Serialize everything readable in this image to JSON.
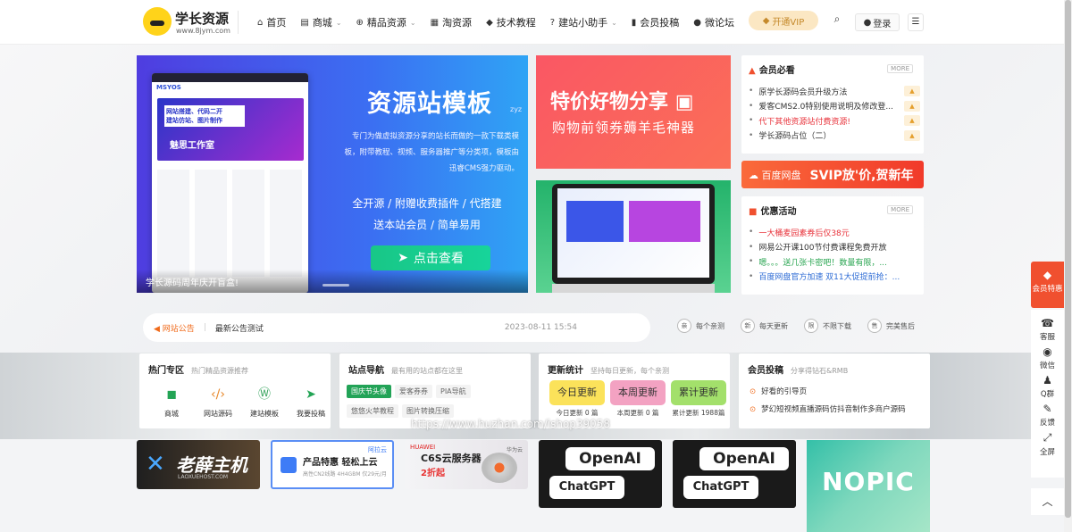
{
  "logo": {
    "title": "学长资源",
    "url_text": "www.8jym.com"
  },
  "nav": [
    {
      "icon": "home-icon",
      "glyph": "⌂",
      "label": "首页",
      "dropdown": false
    },
    {
      "icon": "store-icon",
      "glyph": "▤",
      "label": "商城",
      "dropdown": true
    },
    {
      "icon": "globe-icon",
      "glyph": "⊕",
      "label": "精品资源",
      "dropdown": true
    },
    {
      "icon": "shop-icon",
      "glyph": "▦",
      "label": "淘资源",
      "dropdown": false
    },
    {
      "icon": "graduation-cap-icon",
      "glyph": "◆",
      "label": "技术教程",
      "dropdown": false
    },
    {
      "icon": "question-icon",
      "glyph": "?",
      "label": "建站小助手",
      "dropdown": true
    },
    {
      "icon": "book-icon",
      "glyph": "▮",
      "label": "会员投稿",
      "dropdown": false
    },
    {
      "icon": "chat-icon",
      "glyph": "●",
      "label": "微论坛",
      "dropdown": false
    }
  ],
  "header": {
    "vip_label": "开通VIP",
    "login_label": "登录"
  },
  "hero": {
    "title": "资源站模板",
    "subtitle": "zyz",
    "desc": "专门为做虚拟资源分享的站长而做的一款下载类模板，附带教程、视频、服务器推广等分类项，模板由迅睿CMS强力驱动。",
    "features_1": "全开源 / 附赠收费插件 / 代搭建",
    "features_2": "送本站会员 / 简单易用",
    "button": "点击查看",
    "caption": "学长源码周年庆开盲盒!",
    "mock_brand": "MSYOS",
    "mock_banner_1": "网站搭建、代码二开",
    "mock_banner_2": "建站仿站、图片制作",
    "mock_banner_3": "魅思工作室"
  },
  "ad_sale": {
    "title": "特价好物分享",
    "subtitle": "购物前领券薅羊毛神器"
  },
  "member_must": {
    "title": "会员必看",
    "more": "MORE",
    "items": [
      {
        "text": "原学长源码会员升级方法",
        "style": ""
      },
      {
        "text": "爱客CMS2.0特别使用说明及修改登...",
        "style": ""
      },
      {
        "text": "代下其他资源站付费资源!",
        "style": "red"
      },
      {
        "text": "学长源码占位（二）",
        "style": ""
      }
    ]
  },
  "baidu": {
    "name": "百度网盘",
    "slogan": "SVIP放'价,贺新年"
  },
  "promo": {
    "title": "优惠活动",
    "more": "MORE",
    "items": [
      {
        "text": "一大桶麦园素券后仅38元",
        "style": "red"
      },
      {
        "text": "网易公开课100节付费课程免费开放",
        "style": ""
      },
      {
        "text": "嗯。。。送几张卡密吧！数量有限，...",
        "style": "green"
      },
      {
        "text": "百度网盘官方加速 双11大促提前抢：...",
        "style": "blue"
      }
    ]
  },
  "notice": {
    "label": "网站公告",
    "text": "最新公告测试",
    "date": "2023-08-11 15:54"
  },
  "features": [
    {
      "glyph": "亲",
      "label": "每个亲测"
    },
    {
      "glyph": "新",
      "label": "每天更新"
    },
    {
      "glyph": "限",
      "label": "不限下载"
    },
    {
      "glyph": "售",
      "label": "完美售后"
    }
  ],
  "hot_zone": {
    "title": "热门专区",
    "subtitle": "热门精品资源推荐",
    "links": [
      {
        "icon": "bag-icon",
        "glyph": "◼",
        "color": "#23a455",
        "label": "商城"
      },
      {
        "icon": "code-icon",
        "glyph": "‹/›",
        "color": "#e8892c",
        "label": "网站源码"
      },
      {
        "icon": "wordpress-icon",
        "glyph": "Ⓦ",
        "color": "#3aa660",
        "label": "建站模板"
      },
      {
        "icon": "send-icon",
        "glyph": "➤",
        "color": "#23a455",
        "label": "我要投稿"
      }
    ]
  },
  "site_nav": {
    "title": "站点导航",
    "subtitle": "最有用的站点都在这里",
    "tags": [
      "国庆节头像",
      "爱客券券",
      "PIA导航",
      "悠悠火苹教程",
      "图片转换压缩"
    ]
  },
  "updates": {
    "title": "更新统计",
    "subtitle": "坚持每日更新，每个亲测",
    "items": [
      {
        "label": "今日更新",
        "count": "今日更新 0 篇",
        "color": "#fbe25a"
      },
      {
        "label": "本周更新",
        "count": "本周更新 0 篇",
        "color": "#f3a2c2"
      },
      {
        "label": "累计更新",
        "count": "累计更新 1988篇",
        "color": "#a3e06b"
      }
    ]
  },
  "submit": {
    "title": "会员投稿",
    "subtitle": "分享得钻石&RMB",
    "items": [
      "好看的引导页",
      "梦幻短视频直播源码仿抖音制作多商户源码"
    ]
  },
  "banners": {
    "laoxue": {
      "title": "老薛主机",
      "sub": "LAOXUEHOST.COM"
    },
    "pai": {
      "title": "产品特惠 轻松上云",
      "sub": "高性CN2线路 4H4GBM 仅29元/月",
      "brand": "阿拉云"
    },
    "hw": {
      "logo": "HUAWEI",
      "title": "C6S云服务器",
      "sub": "2折起",
      "corner": "华为云"
    },
    "openai_1": {
      "l1": "OpenAI",
      "l2": "ChatGPT"
    },
    "openai_2": {
      "l1": "OpenAI",
      "l2": "ChatGPT"
    },
    "nopic": "NOPIC"
  },
  "sidebar": {
    "vip": "会员特惠",
    "items": [
      {
        "icon": "service-icon",
        "glyph": "☎",
        "label": "客服"
      },
      {
        "icon": "wechat-icon",
        "glyph": "◉",
        "label": "微信"
      },
      {
        "icon": "qq-icon",
        "glyph": "♟",
        "label": "Q群"
      },
      {
        "icon": "feedback-icon",
        "glyph": "✎",
        "label": "反馈"
      },
      {
        "icon": "fullscreen-icon",
        "glyph": "⤢",
        "label": "全屏"
      }
    ],
    "top_glyph": "︿"
  },
  "watermark": "https://www.huzhan.com/ishop39058"
}
